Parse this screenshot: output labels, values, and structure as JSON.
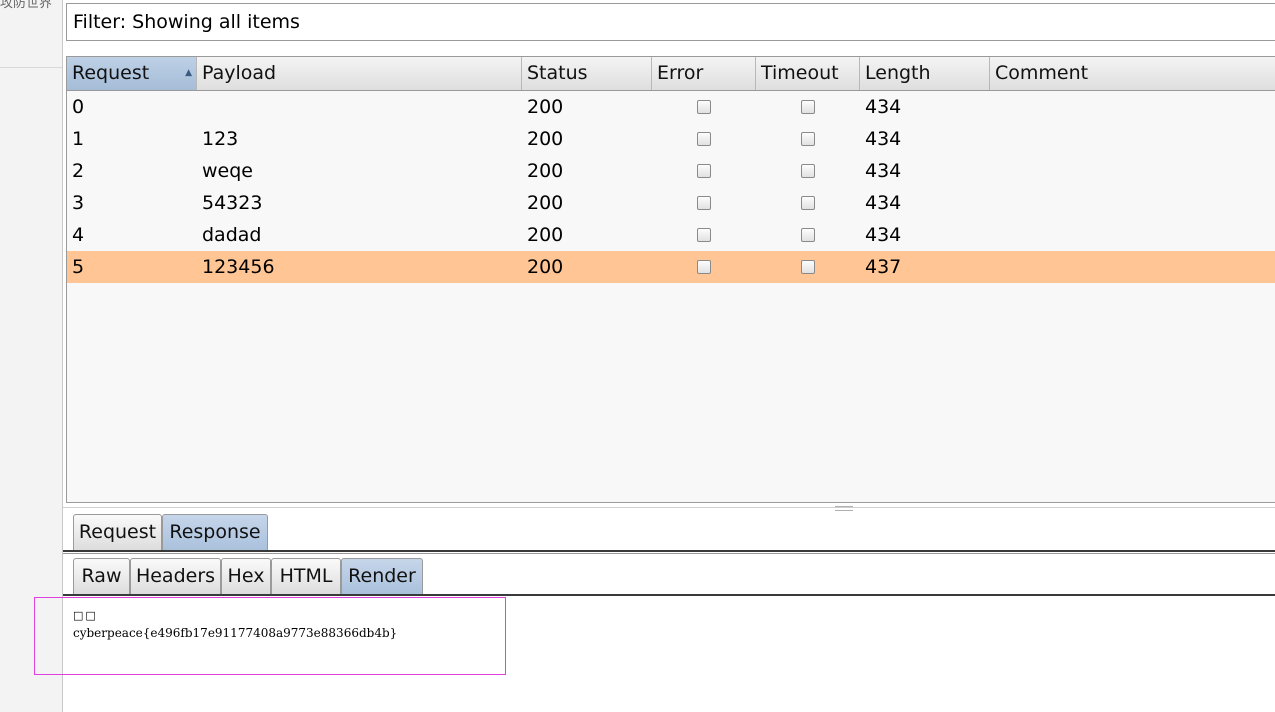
{
  "background": {
    "left_text": "攻防世界"
  },
  "filter": {
    "text": "Filter: Showing all items"
  },
  "table": {
    "columns": [
      {
        "key": "request",
        "label": "Request",
        "sorted": true
      },
      {
        "key": "payload",
        "label": "Payload"
      },
      {
        "key": "status",
        "label": "Status"
      },
      {
        "key": "error",
        "label": "Error"
      },
      {
        "key": "timeout",
        "label": "Timeout"
      },
      {
        "key": "length",
        "label": "Length"
      },
      {
        "key": "comment",
        "label": "Comment"
      }
    ],
    "rows": [
      {
        "request": "0",
        "payload": "",
        "status": "200",
        "error": false,
        "timeout": false,
        "length": "434",
        "comment": ""
      },
      {
        "request": "1",
        "payload": "123",
        "status": "200",
        "error": false,
        "timeout": false,
        "length": "434",
        "comment": ""
      },
      {
        "request": "2",
        "payload": "weqe",
        "status": "200",
        "error": false,
        "timeout": false,
        "length": "434",
        "comment": ""
      },
      {
        "request": "3",
        "payload": "54323",
        "status": "200",
        "error": false,
        "timeout": false,
        "length": "434",
        "comment": ""
      },
      {
        "request": "4",
        "payload": "dadad",
        "status": "200",
        "error": false,
        "timeout": false,
        "length": "434",
        "comment": ""
      },
      {
        "request": "5",
        "payload": "123456",
        "status": "200",
        "error": false,
        "timeout": false,
        "length": "437",
        "comment": "",
        "selected": true
      }
    ]
  },
  "message_tabs": {
    "items": [
      "Request",
      "Response"
    ],
    "active": "Response"
  },
  "view_tabs": {
    "items": [
      "Raw",
      "Headers",
      "Hex",
      "HTML",
      "Render"
    ],
    "active": "Render"
  },
  "render": {
    "glyphs": "□□",
    "text": "cyberpeace{e496fb17e91177408a9773e88366db4b}"
  },
  "colors": {
    "selected_row": "#ffc594",
    "active_tab": "#b4c8e2",
    "highlight_box": "#e040e0"
  }
}
